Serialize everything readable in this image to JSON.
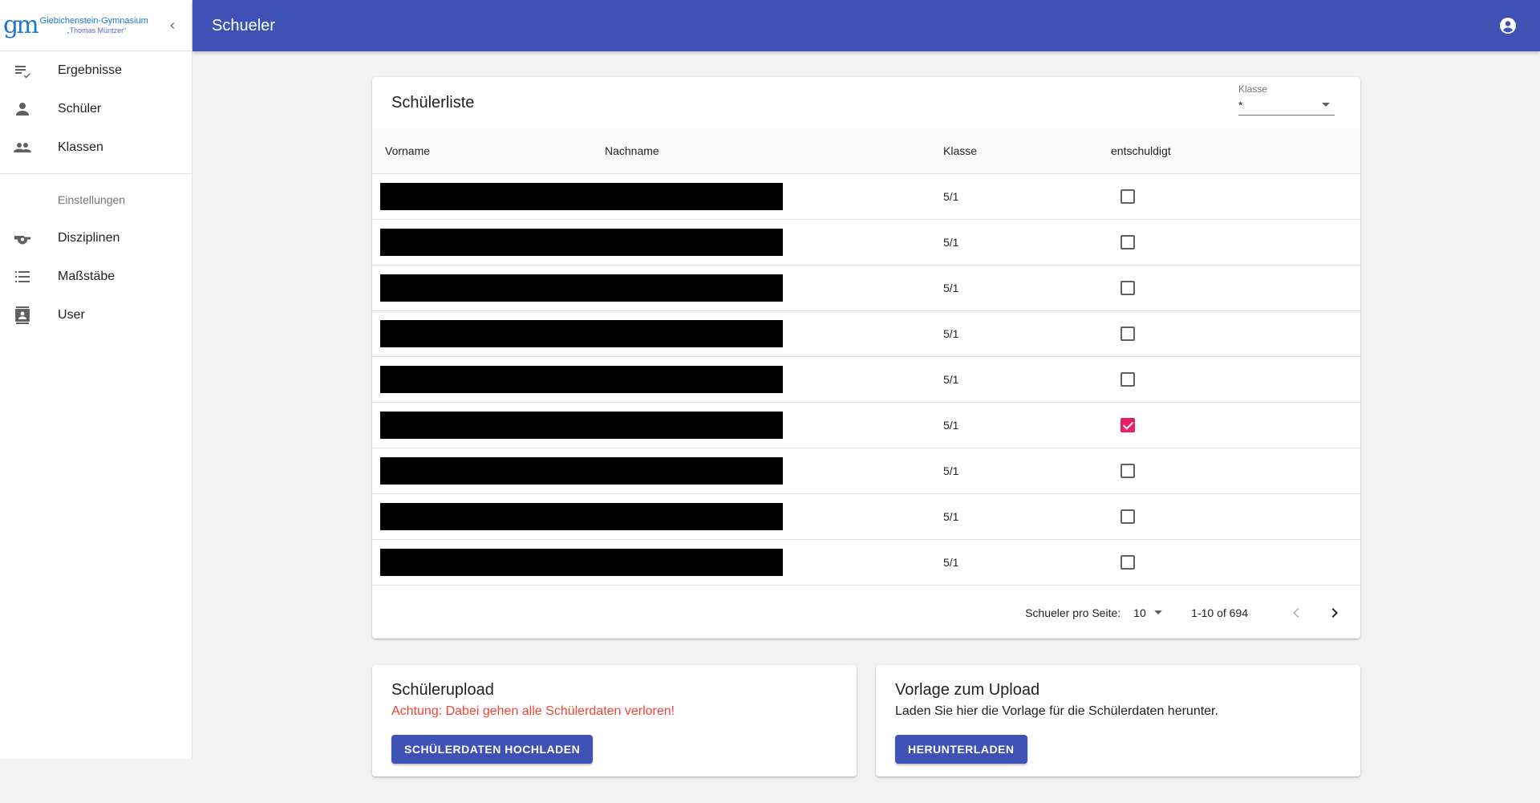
{
  "sidebar": {
    "logo_line1": "Giebichenstein-Gymnasium",
    "logo_line2": "„Thomas Müntzer“",
    "items": [
      {
        "label": "Ergebnisse",
        "icon": "playlist-check-icon"
      },
      {
        "label": "Schüler",
        "icon": "person-icon"
      },
      {
        "label": "Klassen",
        "icon": "people-icon"
      }
    ],
    "settings_header": "Einstellungen",
    "settings_items": [
      {
        "label": "Disziplinen",
        "icon": "whistle-icon"
      },
      {
        "label": "Maßstäbe",
        "icon": "list-icon"
      },
      {
        "label": "User",
        "icon": "contact-card-icon"
      }
    ]
  },
  "appbar": {
    "title": "Schueler"
  },
  "list": {
    "title": "Schülerliste",
    "filter": {
      "label": "Klasse",
      "value": "*"
    },
    "columns": [
      "Vorname",
      "Nachname",
      "Klasse",
      "entschuldigt"
    ],
    "rows": [
      {
        "klasse": "5/1",
        "entschuldigt": false
      },
      {
        "klasse": "5/1",
        "entschuldigt": false
      },
      {
        "klasse": "5/1",
        "entschuldigt": false
      },
      {
        "klasse": "5/1",
        "entschuldigt": false
      },
      {
        "klasse": "5/1",
        "entschuldigt": false
      },
      {
        "klasse": "5/1",
        "entschuldigt": true
      },
      {
        "klasse": "5/1",
        "entschuldigt": false
      },
      {
        "klasse": "5/1",
        "entschuldigt": false
      },
      {
        "klasse": "5/1",
        "entschuldigt": false
      }
    ],
    "pagination": {
      "label": "Schueler pro Seite:",
      "per_page": "10",
      "range": "1-10 of 694"
    }
  },
  "upload": {
    "title": "Schülerupload",
    "warning": "Achtung: Dabei gehen alle Schülerdaten verloren!",
    "button": "SCHÜLERDATEN HOCHLADEN"
  },
  "template": {
    "title": "Vorlage zum Upload",
    "text": "Laden Sie hier die Vorlage für die Schülerdaten herunter.",
    "button": "HERUNTERLADEN"
  },
  "colors": {
    "primary": "#3f51b5",
    "accent": "#e91e63",
    "warning": "#f44336"
  }
}
